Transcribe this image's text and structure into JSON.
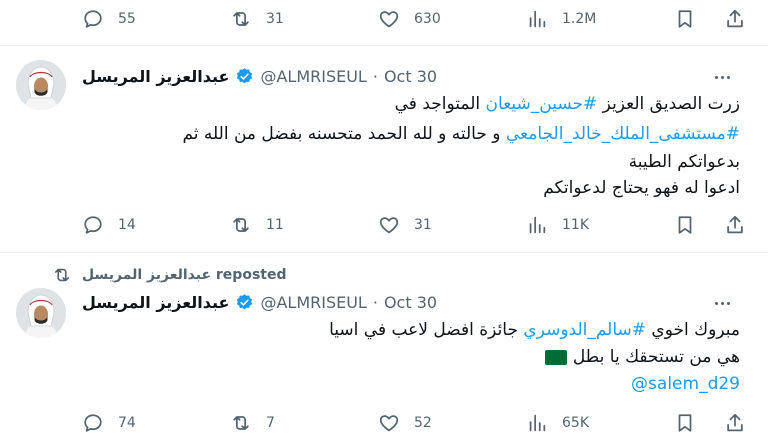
{
  "tweet0": {
    "stats": {
      "replies": "55",
      "reposts": "31",
      "likes": "630",
      "views": "1.2M"
    }
  },
  "tweet1": {
    "author_name": "عبدالعزيز المريسل",
    "handle": "@ALMRISEUL",
    "separator": "·",
    "date": "Oct 30",
    "line1_text": "زرت الصديق العزيز ",
    "line1_hashtag": "#حسين_شيعان",
    "line1_text2": " المتواجد في",
    "line2_hashtag": "#مستشفى_الملك_خالد_الجامعي",
    "line2_text": " و حالته و لله الحمد متحسنه بفضل من الله ثم",
    "line3": "بدعواتكم الطيبة",
    "line4": "ادعوا له فهو يحتاج لدعواتكم",
    "stats": {
      "replies": "14",
      "reposts": "11",
      "likes": "31",
      "views": "11K"
    }
  },
  "repost_label": "عبدالعزيز المريسل reposted",
  "tweet2": {
    "author_name": "عبدالعزيز المريسل",
    "handle": "@ALMRISEUL",
    "separator": "·",
    "date": "Oct 30",
    "line1_text": "مبروك اخوي ",
    "line1_hashtag": "#سالم_الدوسري",
    "line1_text2": " جائزة افضل لاعب في اسيا",
    "line2_text": "هي من تستحقك يا بطل",
    "mention": "@salem_d29",
    "stats": {
      "replies": "74",
      "reposts": "7",
      "likes": "52",
      "views": "65K"
    }
  },
  "icons": {
    "reply": "reply-icon",
    "repost": "repost-icon",
    "like": "heart-icon",
    "views": "views-icon",
    "bookmark": "bookmark-icon",
    "share": "share-icon",
    "verified": "verified-badge-icon",
    "flag": "saudi-flag-icon"
  },
  "colors": {
    "accent": "#1d9bf0",
    "muted": "#536471",
    "text": "#0f1419",
    "divider": "#eff3f4"
  }
}
